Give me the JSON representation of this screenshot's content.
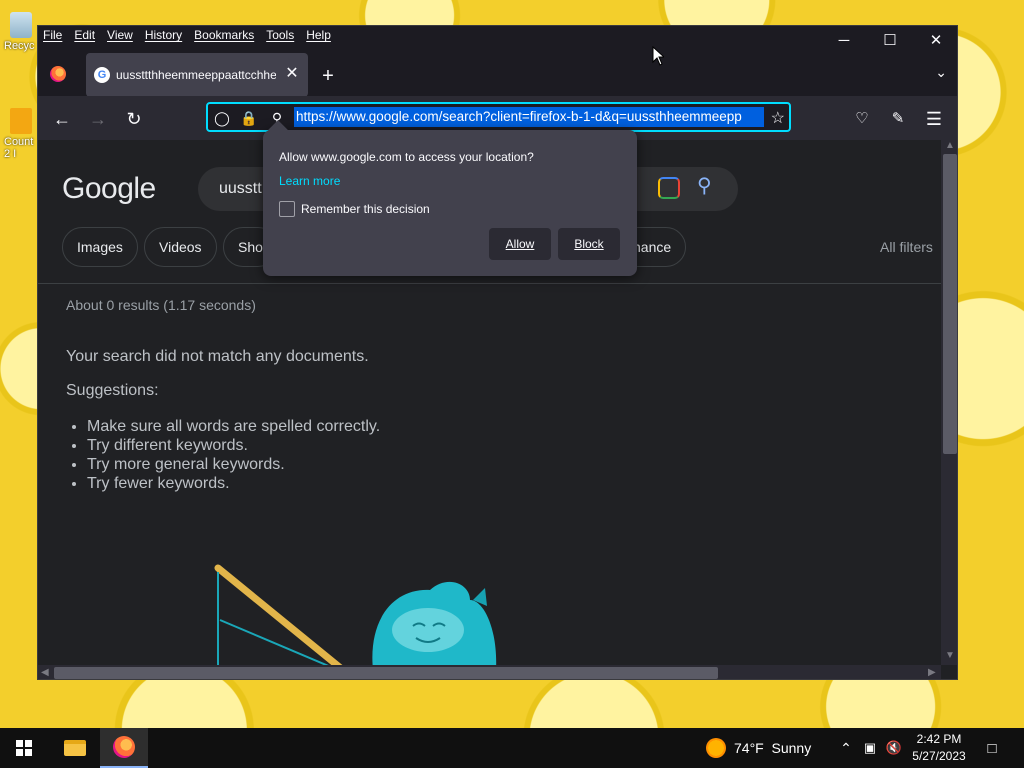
{
  "desktop": {
    "icons": [
      {
        "label": "Recyc",
        "icon": "recycle-bin-icon"
      },
      {
        "label": "Count\n2 I",
        "icon": "shortcut-icon"
      }
    ]
  },
  "browser": {
    "menu": [
      "File",
      "Edit",
      "View",
      "History",
      "Bookmarks",
      "Tools",
      "Help"
    ],
    "window_controls": {
      "minimize": "─",
      "maximize": "☐",
      "close": "✕"
    },
    "tab": {
      "title": "uussttthheemmeeppaattcchhee",
      "close": "✕"
    },
    "new_tab": "+",
    "url": "https://www.google.com/search?client=firefox-b-1-d&q=uussthheemmeepp",
    "accent": "#00ddff"
  },
  "google": {
    "logo": "Google",
    "query": "uusstt",
    "chips": [
      "Images",
      "Videos",
      "Sho",
      "nance"
    ],
    "all_filters": "All filters",
    "stats": "About 0 results (1.17 seconds)",
    "no_match": "Your search did not match any documents.",
    "suggestions_title": "Suggestions:",
    "suggestions": [
      "Make sure all words are spelled correctly.",
      "Try different keywords.",
      "Try more general keywords.",
      "Try fewer keywords."
    ]
  },
  "permission_popup": {
    "message": "Allow www.google.com to access your location?",
    "learn_more": "Learn more",
    "remember": "Remember this decision",
    "allow": "Allow",
    "block": "Block"
  },
  "taskbar": {
    "weather": "74°F  Sunny",
    "time": "2:42 PM",
    "date": "5/27/2023"
  }
}
